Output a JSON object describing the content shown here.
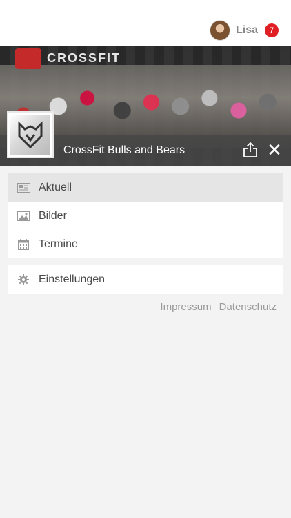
{
  "user": {
    "name": "Lisa",
    "notification_count": "7"
  },
  "gym": {
    "name": "CrossFit Bulls and Bears",
    "wall_text": "CROSSFIT"
  },
  "menu": {
    "items": [
      {
        "label": "Aktuell",
        "icon": "newspaper-icon",
        "active": true
      },
      {
        "label": "Bilder",
        "icon": "image-icon",
        "active": false
      },
      {
        "label": "Termine",
        "icon": "calendar-icon",
        "active": false
      }
    ],
    "settings_label": "Einstellungen"
  },
  "footer": {
    "impressum": "Impressum",
    "datenschutz": "Datenschutz"
  },
  "colors": {
    "badge": "#e01f24",
    "active_item": "#e5e5e5",
    "background": "#f3f3f3"
  }
}
